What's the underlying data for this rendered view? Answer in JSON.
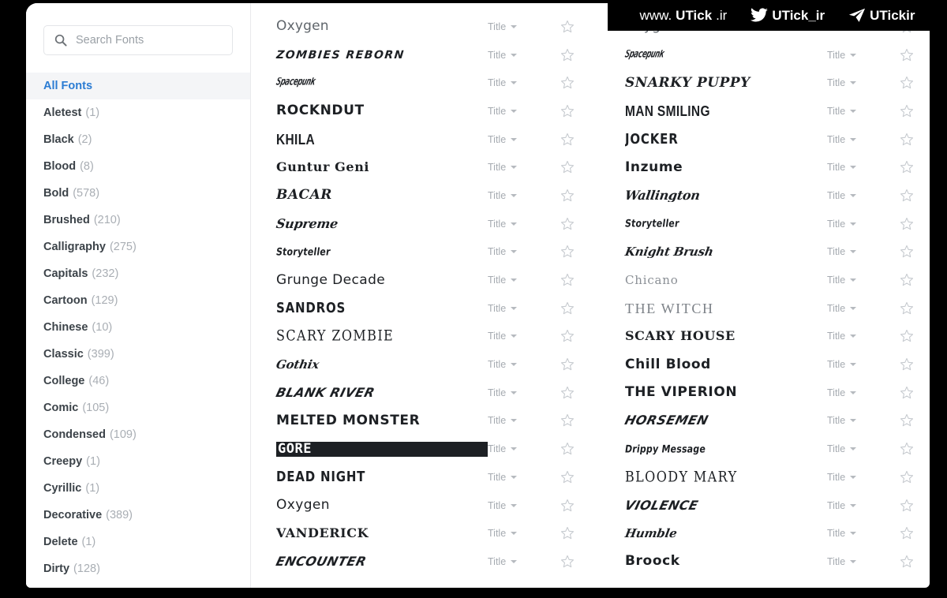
{
  "search": {
    "placeholder": "Search Fonts",
    "value": "",
    "icon": "search-icon"
  },
  "sidebar": {
    "active_label": "All Fonts",
    "items": [
      {
        "label": "All Fonts",
        "count": "",
        "active": true
      },
      {
        "label": "Aletest",
        "count": "(1)",
        "active": false
      },
      {
        "label": "Black",
        "count": "(2)",
        "active": false
      },
      {
        "label": "Blood",
        "count": "(8)",
        "active": false
      },
      {
        "label": "Bold",
        "count": "(578)",
        "active": false
      },
      {
        "label": "Brushed",
        "count": "(210)",
        "active": false
      },
      {
        "label": "Calligraphy",
        "count": "(275)",
        "active": false
      },
      {
        "label": "Capitals",
        "count": "(232)",
        "active": false
      },
      {
        "label": "Cartoon",
        "count": "(129)",
        "active": false
      },
      {
        "label": "Chinese",
        "count": "(10)",
        "active": false
      },
      {
        "label": "Classic",
        "count": "(399)",
        "active": false
      },
      {
        "label": "College",
        "count": "(46)",
        "active": false
      },
      {
        "label": "Comic",
        "count": "(105)",
        "active": false
      },
      {
        "label": "Condensed",
        "count": "(109)",
        "active": false
      },
      {
        "label": "Creepy",
        "count": "(1)",
        "active": false
      },
      {
        "label": "Cyrillic",
        "count": "(1)",
        "active": false
      },
      {
        "label": "Decorative",
        "count": "(389)",
        "active": false
      },
      {
        "label": "Delete",
        "count": "(1)",
        "active": false
      },
      {
        "label": "Dirty",
        "count": "(128)",
        "active": false
      }
    ]
  },
  "row_controls": {
    "preview_mode_label": "Title",
    "caret_icon": "chevron-down-icon",
    "favorite_icon": "star-outline-icon"
  },
  "font_list": {
    "column_left": [
      {
        "name": "Oxygen",
        "style": "s-plain"
      },
      {
        "name": "ZOMBIES REBORN",
        "style": "s-graf"
      },
      {
        "name": "Spacepunk",
        "style": "s-tiny"
      },
      {
        "name": "ROCKNDUT",
        "style": "s-heavy"
      },
      {
        "name": "KHILA",
        "style": "s-cond"
      },
      {
        "name": "Guntur Geni",
        "style": "s-smallc"
      },
      {
        "name": "BACAR",
        "style": "s-ital"
      },
      {
        "name": "Supreme",
        "style": "s-script"
      },
      {
        "name": "Storyteller",
        "style": "s-mini"
      },
      {
        "name": "Grunge Decade",
        "style": "s-round"
      },
      {
        "name": "SANDROS",
        "style": "s-drip"
      },
      {
        "name": "SCARY ZOMBIE",
        "style": "s-caps"
      },
      {
        "name": "Gothix",
        "style": "s-brush"
      },
      {
        "name": "BLANK RIVER",
        "style": "s-wild"
      },
      {
        "name": "MELTED MONSTER",
        "style": "s-heavy"
      },
      {
        "name": "GORE",
        "style": "s-box"
      },
      {
        "name": "DEAD NIGHT",
        "style": "s-drip"
      },
      {
        "name": "Oxygen",
        "style": "s-round"
      },
      {
        "name": "VANDERICK",
        "style": "s-smallc"
      },
      {
        "name": "ENCOUNTER",
        "style": "s-wild"
      }
    ],
    "column_right": [
      {
        "name": "Oxygen",
        "style": "s-plain"
      },
      {
        "name": "Spacepunk",
        "style": "s-tiny"
      },
      {
        "name": "SNARKY PUPPY",
        "style": "s-ital"
      },
      {
        "name": "MAN SMILING",
        "style": "s-cond"
      },
      {
        "name": "JOCKER",
        "style": "s-drip"
      },
      {
        "name": "Inzume",
        "style": "s-heavy"
      },
      {
        "name": "Wallington",
        "style": "s-script"
      },
      {
        "name": "Storyteller",
        "style": "s-mini"
      },
      {
        "name": "Knight Brush",
        "style": "s-brush"
      },
      {
        "name": "Chicano",
        "style": "s-ghost"
      },
      {
        "name": "THE WITCH",
        "style": "s-tall"
      },
      {
        "name": "SCARY HOUSE",
        "style": "s-smallc"
      },
      {
        "name": "Chill Blood",
        "style": "s-heavy"
      },
      {
        "name": "THE VIPERION",
        "style": "s-heavy"
      },
      {
        "name": "HORSEMEN",
        "style": "s-wild"
      },
      {
        "name": "Drippy Message",
        "style": "s-mini"
      },
      {
        "name": "BLOODY MARY",
        "style": "s-caps"
      },
      {
        "name": "VIOLENCE",
        "style": "s-wild"
      },
      {
        "name": "Humble",
        "style": "s-brush"
      },
      {
        "name": "Broock",
        "style": "s-heavy"
      }
    ]
  },
  "watermark": {
    "site_prefix": "www.",
    "site_brand": "UTick",
    "site_suffix": ".ir",
    "twitter_icon": "twitter-bird-icon",
    "twitter_handle": "UTick_ir",
    "telegram_icon": "telegram-plane-icon",
    "telegram_handle": "UTickir"
  },
  "colors": {
    "accent_blue": "#2b7cd3",
    "text_dark": "#1d2024",
    "text_muted": "#a6abb1",
    "sidebar_active_bg": "#f4f5f7",
    "overlay_bg": "#000000"
  }
}
